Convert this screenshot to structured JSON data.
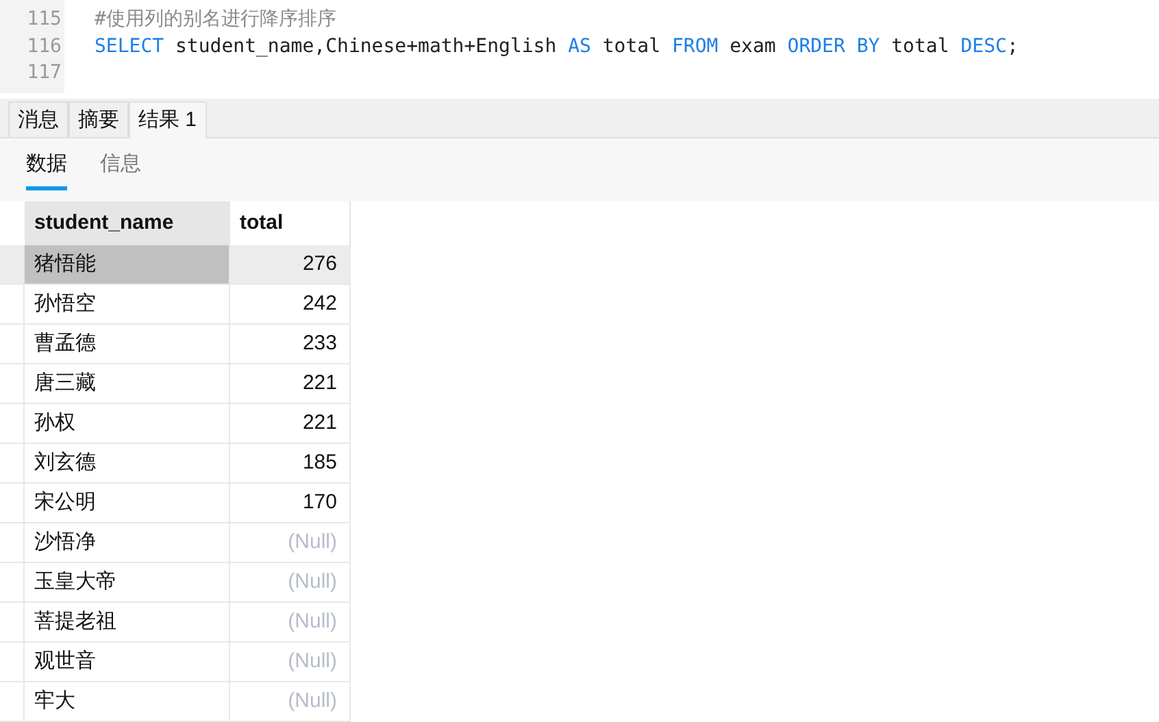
{
  "editor": {
    "lines": [
      {
        "number": "115",
        "tokens": [
          {
            "kind": "comment",
            "text": "#使用列的别名进行降序排序"
          }
        ]
      },
      {
        "number": "116",
        "tokens": [
          {
            "kind": "keyword",
            "text": "SELECT"
          },
          {
            "kind": "plain",
            "text": " student_name,Chinese+math+English "
          },
          {
            "kind": "keyword",
            "text": "AS"
          },
          {
            "kind": "plain",
            "text": " total "
          },
          {
            "kind": "keyword",
            "text": "FROM"
          },
          {
            "kind": "plain",
            "text": " exam "
          },
          {
            "kind": "keyword",
            "text": "ORDER BY"
          },
          {
            "kind": "plain",
            "text": " total "
          },
          {
            "kind": "keyword",
            "text": "DESC"
          },
          {
            "kind": "plain",
            "text": ";"
          }
        ]
      },
      {
        "number": "117"
      }
    ]
  },
  "result_tabs": [
    {
      "label": "消息",
      "selected": false
    },
    {
      "label": "摘要",
      "selected": false
    },
    {
      "label": "结果 1",
      "selected": true
    }
  ],
  "sub_tabs": [
    {
      "label": "数据",
      "selected": true
    },
    {
      "label": "信息",
      "selected": false
    }
  ],
  "table": {
    "columns": [
      "student_name",
      "total"
    ],
    "rows": [
      {
        "name": "猪悟能",
        "total": "276",
        "null": false,
        "selected": true
      },
      {
        "name": "孙悟空",
        "total": "242",
        "null": false,
        "selected": false
      },
      {
        "name": "曹孟德",
        "total": "233",
        "null": false,
        "selected": false
      },
      {
        "name": "唐三藏",
        "total": "221",
        "null": false,
        "selected": false
      },
      {
        "name": "孙权",
        "total": "221",
        "null": false,
        "selected": false
      },
      {
        "name": "刘玄德",
        "total": "185",
        "null": false,
        "selected": false
      },
      {
        "name": "宋公明",
        "total": "170",
        "null": false,
        "selected": false
      },
      {
        "name": "沙悟净",
        "total": "(Null)",
        "null": true,
        "selected": false
      },
      {
        "name": "玉皇大帝",
        "total": "(Null)",
        "null": true,
        "selected": false
      },
      {
        "name": "菩提老祖",
        "total": "(Null)",
        "null": true,
        "selected": false
      },
      {
        "name": "观世音",
        "total": "(Null)",
        "null": true,
        "selected": false
      },
      {
        "name": "牢大",
        "total": "(Null)",
        "null": true,
        "selected": false
      }
    ]
  }
}
